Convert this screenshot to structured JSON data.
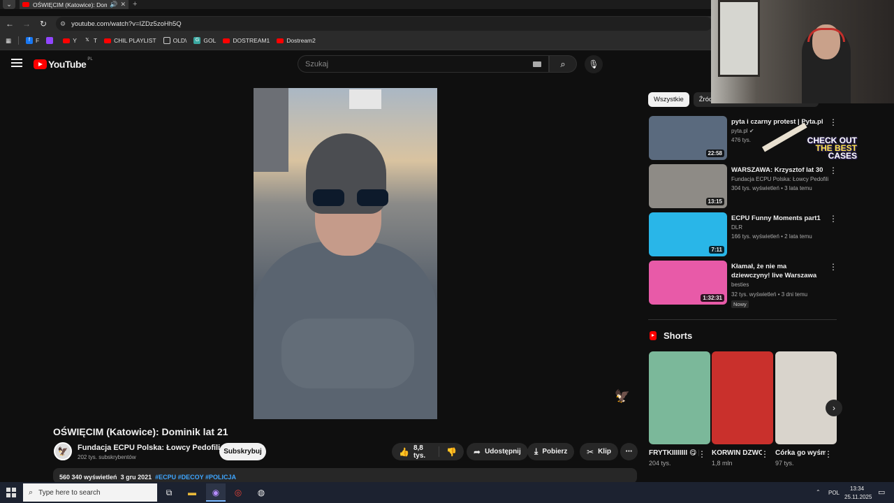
{
  "browser": {
    "tab_title": "OŚWIĘCIM (Katowice): Dom",
    "url": "youtube.com/watch?v=IZDz5zoHh5Q",
    "bookmarks": [
      "F",
      "Y",
      "T",
      "CHIL PLAYLIST",
      "OLD\\",
      "GOL",
      "DOSTREAM1",
      "Dostream2"
    ]
  },
  "yt": {
    "logo": "YouTube",
    "region": "PL",
    "search_placeholder": "Szukaj"
  },
  "video": {
    "title": "OŚWIĘCIM (Katowice): Dominik lat 21",
    "channel": "Fundacja ECPU Polska: Łowcy Pedofili",
    "subscribers": "202 tys. subskrybentów",
    "subscribe_label": "Subskrybuj",
    "likes": "8,8 tys.",
    "share_label": "Udostępnij",
    "download_label": "Pobierz",
    "clip_label": "Klip",
    "views": "560 340 wyświetleń",
    "date": "3 gru 2021",
    "tags": "#ECPU #DECOY #POLICJA"
  },
  "chips": [
    "Wszystkie",
    "Źródło: Fundacja ECPU Polska: Łowcy"
  ],
  "recommended": [
    {
      "title": "pyta i czarny protest | Pyta.pl",
      "channel": "pyta.pl",
      "meta": "476 tys.",
      "duration": "22:58",
      "color": "#5a6a7e"
    },
    {
      "title": "WARSZAWA: Krzysztof lat 30",
      "channel": "Fundacja ECPU Polska: Łowcy Pedofili",
      "meta": "304 tys. wyświetleń • 3 lata temu",
      "duration": "13:15",
      "color": "#8e8b86"
    },
    {
      "title": "ECPU Funny Moments part1",
      "channel": "DLR",
      "meta": "166 tys. wyświetleń • 2 lata temu",
      "duration": "7:11",
      "color": "#29b6e8"
    },
    {
      "title": "Kłamał, że nie ma dziewczyny! live Warszawa",
      "channel": "besties",
      "meta": "32 tys. wyświetleń • 3 dni temu",
      "duration": "1:32:31",
      "color": "#e85aa8",
      "badge": "Nowy"
    }
  ],
  "promo": {
    "line1": "CHECK OUT",
    "line2": "THE BEST",
    "line3": "CASES"
  },
  "shorts": {
    "heading": "Shorts",
    "items": [
      {
        "title": "FRYTKIIIIIIII 😋 | Życie ...",
        "views": "204 tys.",
        "color": "#7bb89a"
      },
      {
        "title": "KORWIN DZWONI D...",
        "views": "1,8 mln",
        "color": "#c9302c"
      },
      {
        "title": "Córka go wyśmiała, ...",
        "views": "97 tys.",
        "color": "#d9d4cc"
      }
    ]
  },
  "taskbar": {
    "search_placeholder": "Type here to search",
    "lang": "POL",
    "time": "13:34",
    "date": "25.11.2025"
  }
}
